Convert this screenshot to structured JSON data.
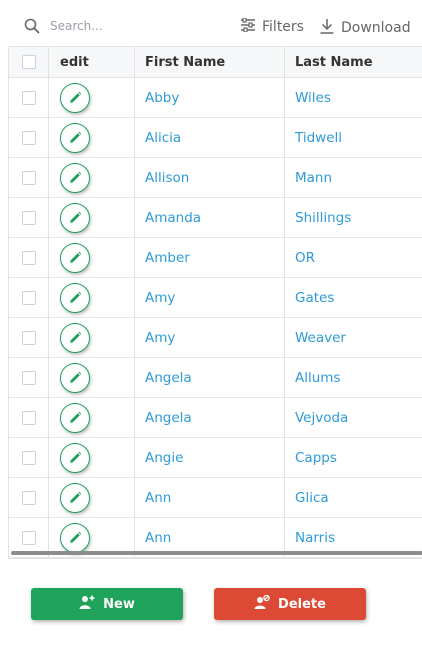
{
  "toolbar": {
    "search_placeholder": "Search...",
    "filters_label": "Filters",
    "download_label": "Download"
  },
  "table": {
    "columns": [
      "edit",
      "First Name",
      "Last Name"
    ],
    "rows": [
      {
        "first": "Abby",
        "last": "Wiles"
      },
      {
        "first": "Alicia",
        "last": "Tidwell"
      },
      {
        "first": "Allison",
        "last": "Mann"
      },
      {
        "first": "Amanda",
        "last": "Shillings"
      },
      {
        "first": "Amber",
        "last": "OR"
      },
      {
        "first": "Amy",
        "last": "Gates"
      },
      {
        "first": "Amy",
        "last": "Weaver"
      },
      {
        "first": "Angela",
        "last": "Allums"
      },
      {
        "first": "Angela",
        "last": "Vejvoda"
      },
      {
        "first": "Angie",
        "last": "Capps"
      },
      {
        "first": "Ann",
        "last": "Glica"
      },
      {
        "first": "Ann",
        "last": "Narris"
      }
    ]
  },
  "actions": {
    "new_label": "New",
    "delete_label": "Delete"
  },
  "colors": {
    "link": "#2e9bd6",
    "new_button": "#1fa35a",
    "delete_button": "#dc4a35",
    "edit_icon": "#1f9e5a"
  },
  "icons": {
    "search": "search-icon",
    "filters": "sliders-icon",
    "download": "download-icon",
    "edit": "pencil-icon",
    "new": "add-user-icon",
    "delete": "remove-user-icon"
  }
}
